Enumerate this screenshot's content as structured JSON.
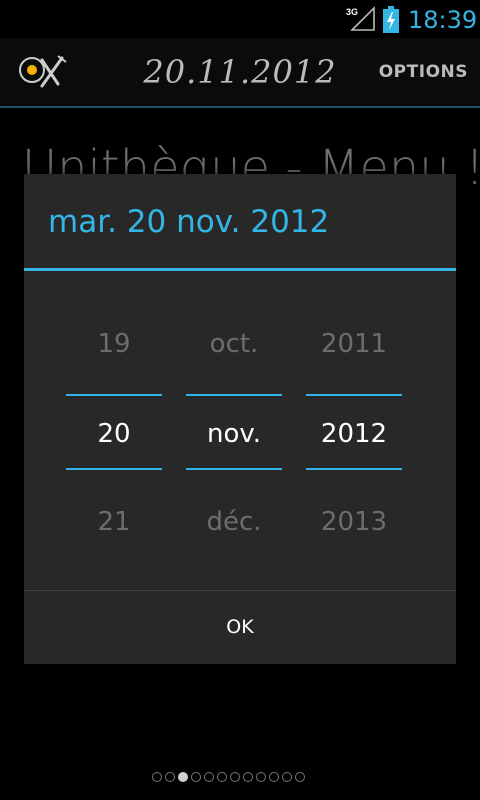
{
  "status_bar": {
    "network": "3G",
    "time": "18:39",
    "accent_color": "#33b5e5"
  },
  "action_bar": {
    "title": "20.11.2012",
    "options_label": "OPTIONS",
    "logo_icon": "egg-fork-knife-icon"
  },
  "background": {
    "heading": "Unithèque - Menu !"
  },
  "dialog": {
    "title": "mar. 20 nov. 2012",
    "day": {
      "prev": "19",
      "current": "20",
      "next": "21"
    },
    "month": {
      "prev": "oct.",
      "current": "nov.",
      "next": "déc."
    },
    "year": {
      "prev": "2011",
      "current": "2012",
      "next": "2013"
    },
    "ok_label": "OK"
  },
  "pager": {
    "total_pages": 12,
    "active_index": 2
  }
}
